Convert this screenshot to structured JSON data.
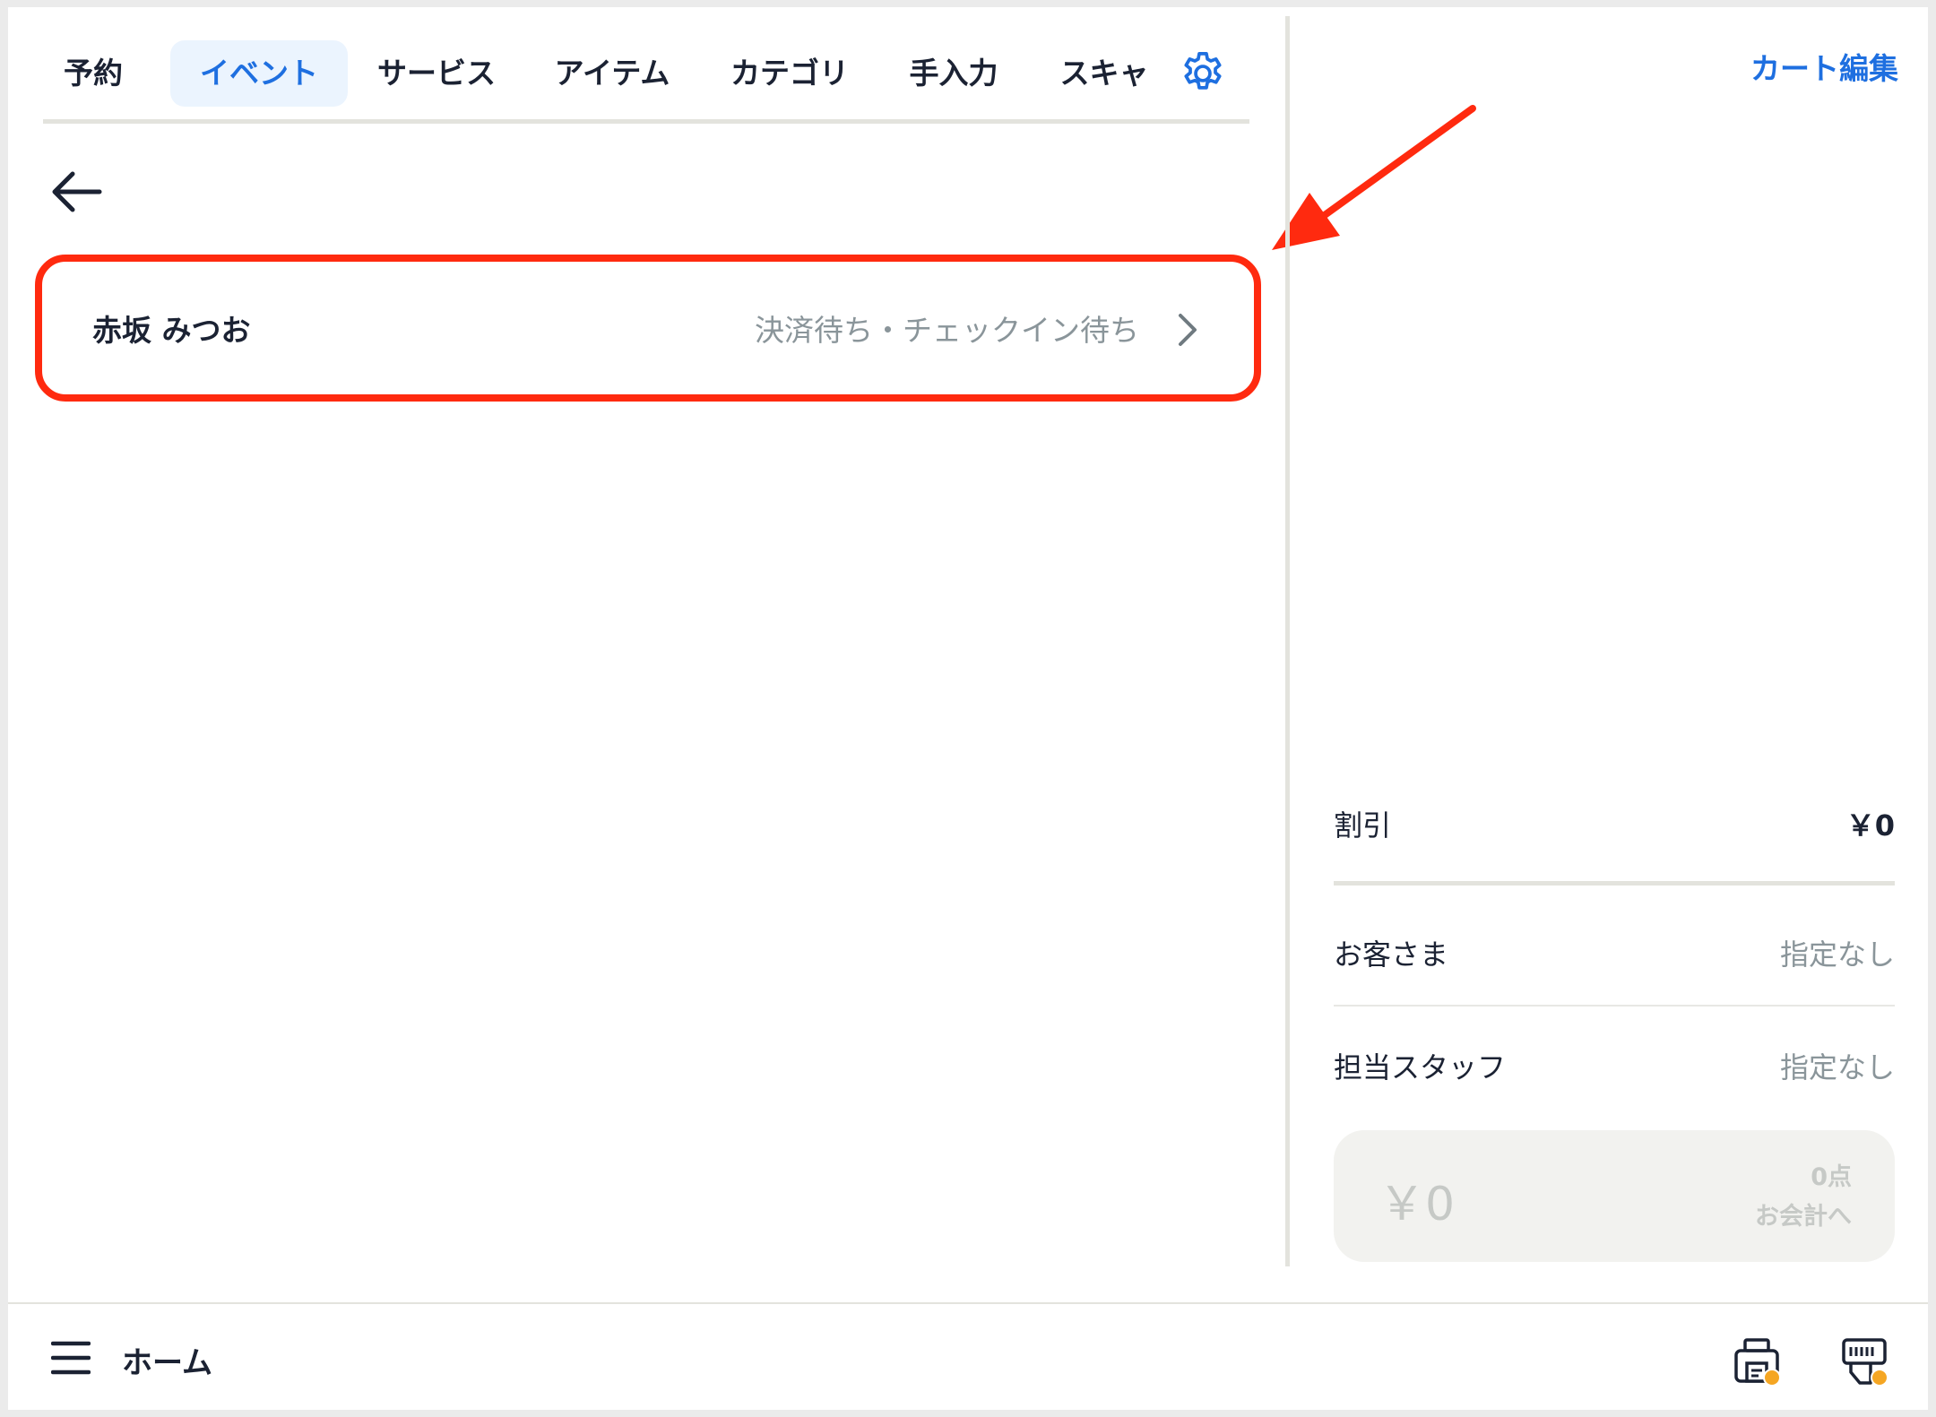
{
  "tabs": [
    {
      "label": "予約",
      "active": false
    },
    {
      "label": "イベント",
      "active": true
    },
    {
      "label": "サービス",
      "active": false
    },
    {
      "label": "アイテム",
      "active": false
    },
    {
      "label": "カテゴリ",
      "active": false
    },
    {
      "label": "手入力",
      "active": false
    },
    {
      "label": "スキャ",
      "active": false
    }
  ],
  "icons": {
    "settings": "gear-icon",
    "back": "arrow-left-icon",
    "chevron": "chevron-right-icon",
    "menu": "hamburger-menu-icon",
    "printer": "printer-icon",
    "card_reader": "card-reader-icon",
    "annotation": "red-arrow-annotation"
  },
  "event_list": [
    {
      "name": "赤坂 みつお",
      "status": "決済待ち・チェックイン待ち"
    }
  ],
  "cart": {
    "edit_label": "カート編集",
    "discount": {
      "label": "割引",
      "value": "￥0"
    },
    "customer": {
      "label": "お客さま",
      "value": "指定なし"
    },
    "staff": {
      "label": "担当スタッフ",
      "value": "指定なし"
    },
    "checkout": {
      "amount": "￥0",
      "count": "0点",
      "label": "お会計へ"
    }
  },
  "bottom_bar": {
    "home_label": "ホーム"
  },
  "colors": {
    "accent": "#1e6fe0",
    "active_tab_bg": "#ebf4fe",
    "highlight": "#ff2a0f",
    "status_dot": "#f5a623",
    "muted_text": "#8a959a",
    "divider": "#e3e3dd"
  }
}
